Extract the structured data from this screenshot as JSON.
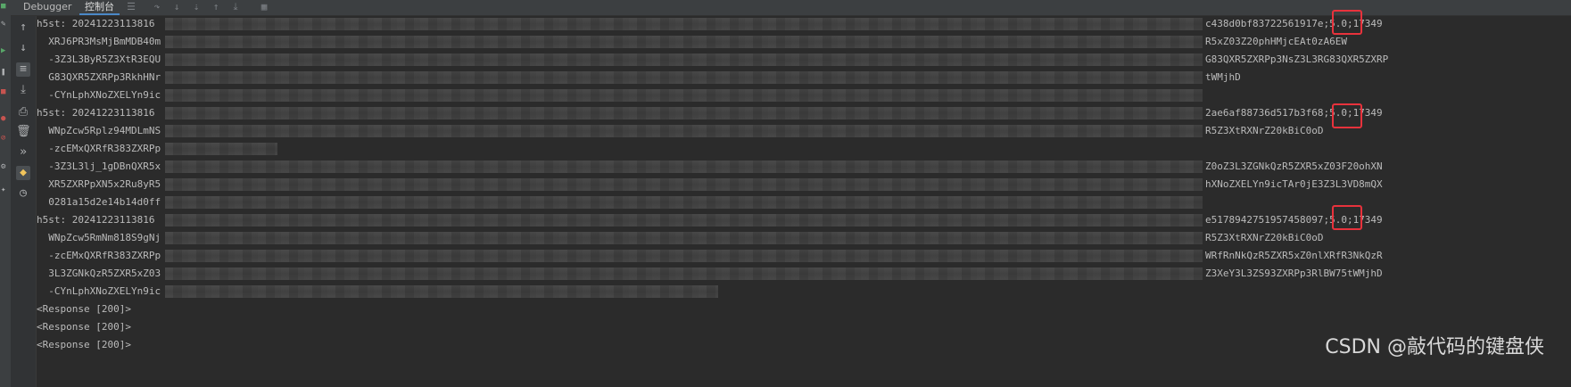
{
  "tabs": {
    "debugger": "Debugger",
    "console": "控制台"
  },
  "left_icons": [
    "run-icon",
    "wrench-icon",
    "resume-icon",
    "pause-icon",
    "stop-icon",
    "breakpoint-icon",
    "mute-icon",
    "settings-icon",
    "pin-icon"
  ],
  "toolbar_icons": [
    "menu-icon",
    "step-over-icon",
    "step-into-icon",
    "force-step-icon",
    "step-out-icon",
    "run-to-cursor-icon",
    "evaluate-icon"
  ],
  "gutter_icons": [
    "up-arrow-icon",
    "down-arrow-icon",
    "soft-wrap-icon",
    "scroll-to-end-icon",
    "print-icon",
    "trash-icon",
    "more-icon",
    "python-console-icon",
    "clock-icon"
  ],
  "lines": [
    "h5st: 20241223113816",
    "  XRJ6PR3MsMjBmMDB40m",
    "  -3Z3L3ByR5Z3XtR3EQU",
    "  G83QXR5ZXRPp3RkhHNr",
    "  -CYnLphXNoZXELYn9ic",
    "h5st: 20241223113816",
    "  WNpZcw5Rplz94MDLmNS",
    "  -zcEMxQXRfR383ZXRPp",
    "  -3Z3L3lj_1gDBnQXR5x",
    "  XR5ZXRPpXN5x2Ru8yR5",
    "  0281a15d2e14b14d0ff",
    "h5st: 20241223113816",
    "  WNpZcw5RmNm818S9gNj",
    "  -zcEMxQXRfR383ZXRPp",
    "  3L3ZGNkQzR5ZXR5xZ03",
    "  -CYnLphXNoZXELYn9ic",
    "<Response [200]>",
    "<Response [200]>",
    "<Response [200]>"
  ],
  "right_lines": [
    "c438d0bf83722561917e;5.0;17349",
    "R5xZ03Z20phHMjcEAt0zA6EW",
    "G83QXR5ZXRPp3NsZ3L3RG83QXR5ZXRP",
    "tWMjhD",
    "",
    "2ae6af88736d517b3f68;5.0;17349",
    "R5Z3XtRXNrZ20kBiC0oD",
    "",
    "Z0oZ3L3ZGNkQzR5ZXR5xZ03F20ohXN",
    "hXNoZXELYn9icTAr0jE3Z3L3VD8mQX",
    "",
    "e5178942751957458097;5.0;17349",
    "R5Z3XtRXNrZ20kBiC0oD",
    "WRfRnNkQzR5ZXR5xZ0nlXRfR3NkQzR",
    "Z3XeY3L3ZS93ZXRPp3RlBW75tWMjhD",
    "",
    "",
    "",
    ""
  ],
  "highlight_values": [
    "5.0",
    "5.0",
    "5.0"
  ],
  "watermark": "CSDN @敲代码的键盘侠",
  "colors": {
    "highlight_border": "#e8323c",
    "background": "#2b2b2b",
    "text": "#bbbbbb"
  }
}
